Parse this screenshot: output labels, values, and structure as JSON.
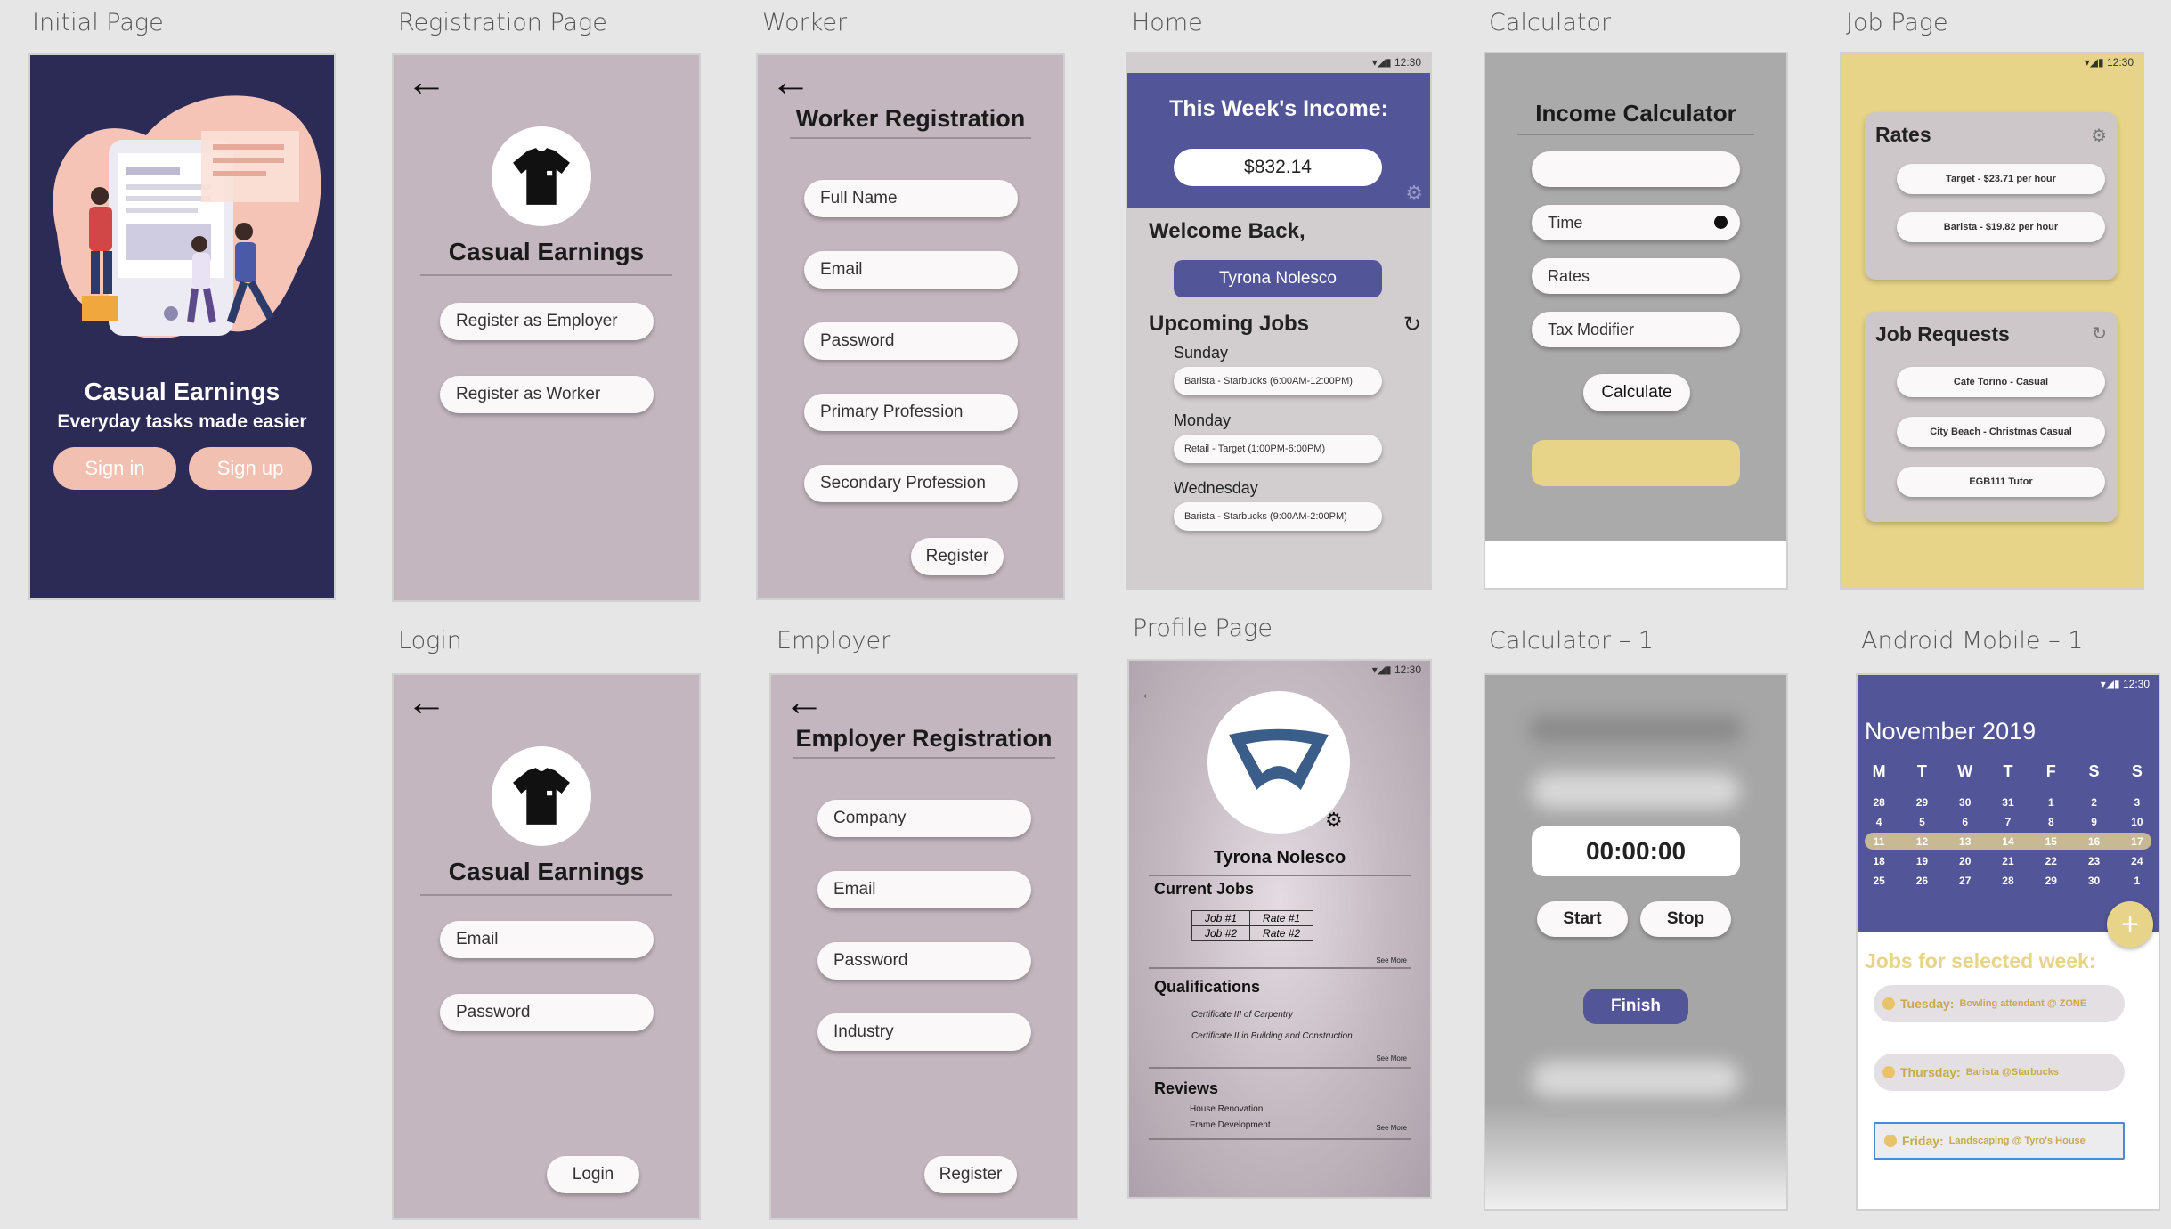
{
  "labels": {
    "initial": "Initial Page",
    "registration": "Registration Page",
    "worker": "Worker",
    "home": "Home",
    "calculator": "Calculator",
    "job": "Job Page",
    "login": "Login",
    "employer": "Employer",
    "profile": "Profile Page",
    "calculator1": "Calculator – 1",
    "android": "Android Mobile – 1"
  },
  "initial": {
    "title": "Casual Earnings",
    "subtitle": "Everyday tasks made easier",
    "signin": "Sign in",
    "signup": "Sign up"
  },
  "registration": {
    "title": "Casual Earnings",
    "employer_btn": "Register as Employer",
    "worker_btn": "Register as Worker"
  },
  "worker": {
    "title": "Worker Registration",
    "fields": [
      "Full Name",
      "Email",
      "Password",
      "Primary Profession",
      "Secondary Profession"
    ],
    "register": "Register"
  },
  "home": {
    "status_time": "12:30",
    "income_title": "This Week's Income:",
    "income": "$832.14",
    "welcome": "Welcome Back,",
    "user": "Tyrona Nolesco",
    "upcoming": "Upcoming Jobs",
    "jobs": [
      {
        "day": "Sunday",
        "detail": "Barista - Starbucks (6:00AM-12:00PM)"
      },
      {
        "day": "Monday",
        "detail": "Retail - Target (1:00PM-6:00PM)"
      },
      {
        "day": "Wednesday",
        "detail": "Barista - Starbucks (9:00AM-2:00PM)"
      }
    ]
  },
  "calculator": {
    "title": "Income Calculator",
    "time": "Time",
    "rates": "Rates",
    "tax": "Tax Modifier",
    "calculate": "Calculate"
  },
  "job": {
    "status_time": "12:30",
    "rates_title": "Rates",
    "rates": [
      "Target - $23.71 per hour",
      "Barista - $19.82 per hour"
    ],
    "requests_title": "Job Requests",
    "requests": [
      "Café Torino - Casual",
      "City Beach - Christmas Casual",
      "EGB111 Tutor"
    ]
  },
  "login": {
    "title": "Casual Earnings",
    "email": "Email",
    "password": "Password",
    "login": "Login"
  },
  "employer": {
    "title": "Employer Registration",
    "fields": [
      "Company",
      "Email",
      "Password",
      "Industry"
    ],
    "register": "Register"
  },
  "profile": {
    "status_time": "12:30",
    "name": "Tyrona Nolesco",
    "current_jobs": "Current Jobs",
    "table": [
      [
        "Job #1",
        "Rate #1"
      ],
      [
        "Job #2",
        "Rate #2"
      ]
    ],
    "see_more": "See More",
    "qualifications": "Qualifications",
    "quals": [
      "Certificate III of Carpentry",
      "Certificate II in Building and Construction"
    ],
    "reviews": "Reviews",
    "review_items": [
      "House Renovation",
      "Frame Development"
    ]
  },
  "calc1": {
    "timer": "00:00:00",
    "start": "Start",
    "stop": "Stop",
    "finish": "Finish"
  },
  "android": {
    "status_time": "12:30",
    "month": "November 2019",
    "weekdays": [
      "M",
      "T",
      "W",
      "T",
      "F",
      "S",
      "S"
    ],
    "weeks": [
      [
        "28",
        "29",
        "30",
        "31",
        "1",
        "2",
        "3"
      ],
      [
        "4",
        "5",
        "6",
        "7",
        "8",
        "9",
        "10"
      ],
      [
        "11",
        "12",
        "13",
        "14",
        "15",
        "16",
        "17"
      ],
      [
        "18",
        "19",
        "20",
        "21",
        "22",
        "23",
        "24"
      ],
      [
        "25",
        "26",
        "27",
        "28",
        "29",
        "30",
        "1"
      ]
    ],
    "selected_week": 2,
    "jobs_title": "Jobs for selected week:",
    "week_jobs": [
      {
        "day": "Tuesday:",
        "detail": "Bowling attendant @ ZONE"
      },
      {
        "day": "Thursday:",
        "detail": "Barista @Starbucks"
      },
      {
        "day": "Friday:",
        "detail": "Landscaping @ Tyro's House"
      }
    ]
  },
  "colors": {
    "navy": "#2b2b55",
    "mauve": "#c4b6be",
    "indigo": "#525597",
    "yellow": "#e8d489",
    "peach": "#f2c0b1"
  }
}
